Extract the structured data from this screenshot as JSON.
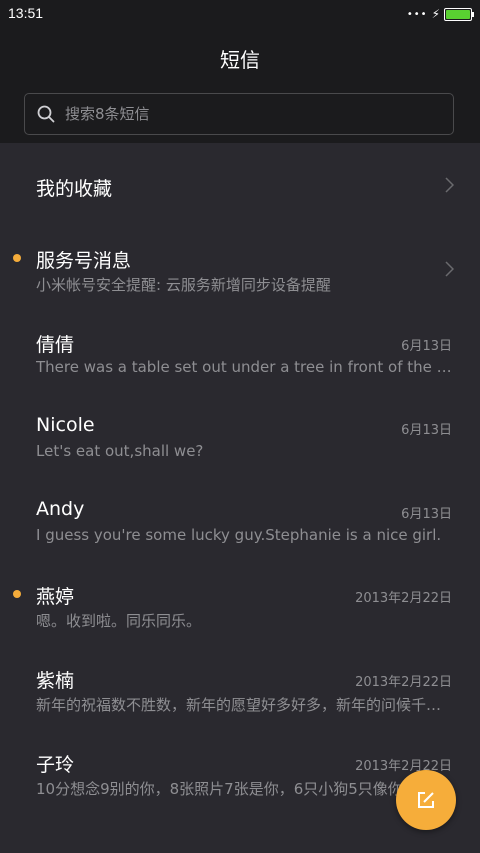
{
  "status_bar": {
    "time": "13:51",
    "signal_dots": "•••",
    "battery_level": 1.0,
    "battery_color": "#59d131"
  },
  "header": {
    "title": "短信"
  },
  "search": {
    "placeholder": "搜索8条短信",
    "value": ""
  },
  "colors": {
    "accent": "#f6ad3a",
    "unread_dot": "#f4ac3b",
    "list_bg": "#2a292f",
    "secondary_text": "#8e8e92"
  },
  "conversations": [
    {
      "title": "我的收藏",
      "preview": "",
      "date": "",
      "unread": false,
      "chevron": true
    },
    {
      "title": "服务号消息",
      "preview": "小米帐号安全提醒: 云服务新增同步设备提醒",
      "date": "",
      "unread": true,
      "chevron": true
    },
    {
      "title": "倩倩",
      "preview": "There was a table set out under a tree in front of the house",
      "date": "6月13日",
      "unread": false,
      "chevron": false
    },
    {
      "title": "Nicole",
      "preview": "Let's eat out,shall we?",
      "date": "6月13日",
      "unread": false,
      "chevron": false
    },
    {
      "title": "Andy",
      "preview": "I guess you're some lucky guy.Stephanie is a nice girl.",
      "date": "6月13日",
      "unread": false,
      "chevron": false
    },
    {
      "title": "燕婷",
      "preview": "嗯。收到啦。同乐同乐。",
      "date": "2013年2月22日",
      "unread": true,
      "chevron": false
    },
    {
      "title": "紫楠",
      "preview": "新年的祝福数不胜数，新年的愿望好多好多，新年的问候千千万万",
      "date": "2013年2月22日",
      "unread": false,
      "chevron": false
    },
    {
      "title": "子玲",
      "preview": "10分想念9别的你，8张照片7张是你，6只小狗5只像你",
      "date": "2013年2月22日",
      "unread": false,
      "chevron": false
    }
  ],
  "fab": {
    "icon": "compose-icon"
  }
}
